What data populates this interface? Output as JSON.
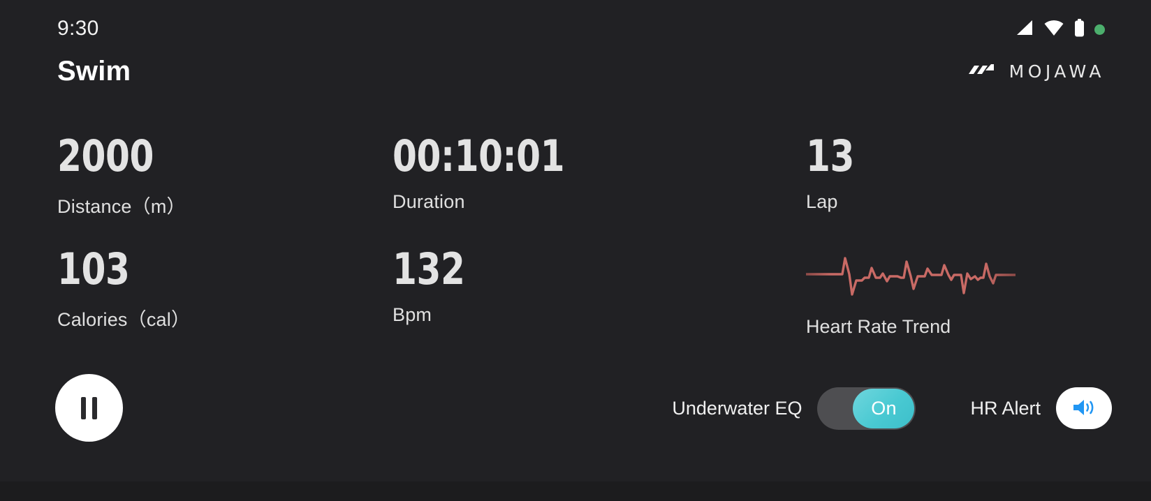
{
  "status": {
    "time": "9:30",
    "icons": [
      "signal-icon",
      "wifi-icon",
      "battery-icon",
      "recording-dot-icon"
    ]
  },
  "header": {
    "title": "Swim",
    "brand": "MOJAWA",
    "brand_mark": "mojawa-logo-icon"
  },
  "metrics": {
    "row1": [
      {
        "value": "2000",
        "label": "Distance（m）",
        "name": "distance"
      },
      {
        "value": "00:10:01",
        "label": "Duration",
        "name": "duration"
      },
      {
        "value": "13",
        "label": "Lap",
        "name": "lap"
      }
    ],
    "row2": [
      {
        "value": "103",
        "label": "Calories（cal）",
        "name": "calories"
      },
      {
        "value": "132",
        "label": "Bpm",
        "name": "bpm"
      }
    ],
    "heart_rate_trend": {
      "label": "Heart Rate Trend",
      "color": "#c96a65",
      "icon": "ecg-waveform-icon"
    }
  },
  "controls": {
    "pause_button": {
      "name": "pause-button",
      "icon": "pause-icon"
    },
    "underwater_eq": {
      "label": "Underwater EQ",
      "state": "On",
      "enabled": true,
      "track_color": "#4e4e51",
      "knob_color": "#49c9d2"
    },
    "hr_alert": {
      "label": "HR Alert",
      "icon": "speaker-on-icon",
      "icon_color": "#2196f3"
    }
  },
  "theme": {
    "background": "#212124",
    "text_primary": "#e3e3e3",
    "accent_teal": "#49c9d2",
    "accent_blue": "#2196f3",
    "accent_red": "#c96a65",
    "status_dot_green": "#4caf6d"
  }
}
